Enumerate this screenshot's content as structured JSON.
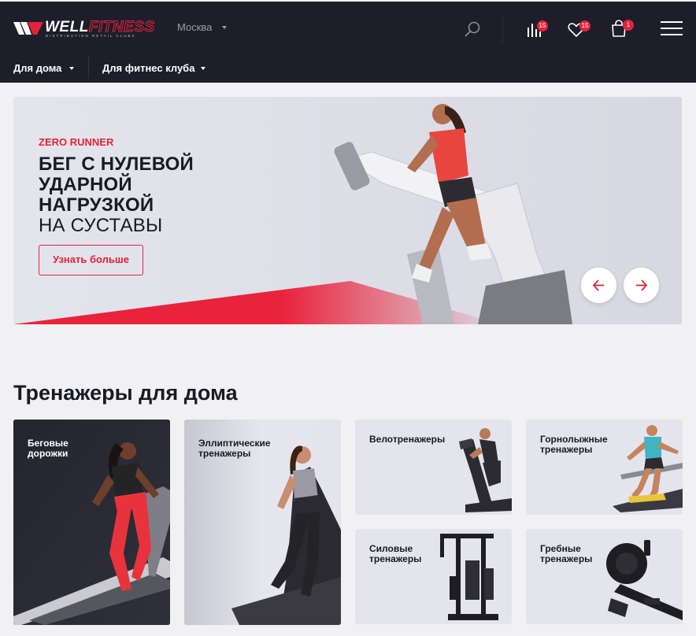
{
  "header": {
    "logo": {
      "word_well": "WELL",
      "word_fitness": "FITNESS",
      "tagline": "DISTRIBUTION RETAIL CLUBS"
    },
    "city": "Москва",
    "search_icon": "search-icon",
    "compare": {
      "icon": "compare-chart-icon",
      "count": "15"
    },
    "favorites": {
      "icon": "heart-icon",
      "count": "15"
    },
    "cart": {
      "icon": "shopping-bag-icon",
      "count": "1"
    },
    "menu_icon": "hamburger-menu-icon"
  },
  "nav": {
    "items": [
      {
        "label": "Для дома"
      },
      {
        "label": "Для фитнес клуба"
      }
    ]
  },
  "hero": {
    "kicker": "ZERO RUNNER",
    "title_line1": "БЕГ С НУЛЕВОЙ",
    "title_line2": "УДАРНОЙ",
    "title_line3": "НАГРУЗКОЙ",
    "title_line4": "НА СУСТАВЫ",
    "cta": "Узнать больше",
    "prev_icon": "arrow-left-icon",
    "next_icon": "arrow-right-icon"
  },
  "section": {
    "title": "Тренажеры для дома",
    "categories": [
      {
        "label": "Беговые\nдорожки"
      },
      {
        "label": "Эллиптические\nтренажеры"
      },
      {
        "label": "Велотренажеры"
      },
      {
        "label": "Горнолыжные\nтренажеры"
      },
      {
        "label": "Силовые\nтренажеры"
      },
      {
        "label": "Гребные\nтренажеры"
      }
    ]
  },
  "colors": {
    "accent": "#e2233a",
    "header_bg": "#1d1e2a",
    "page_bg": "#f1f1f3",
    "card_bg": "#e4e4ec"
  }
}
